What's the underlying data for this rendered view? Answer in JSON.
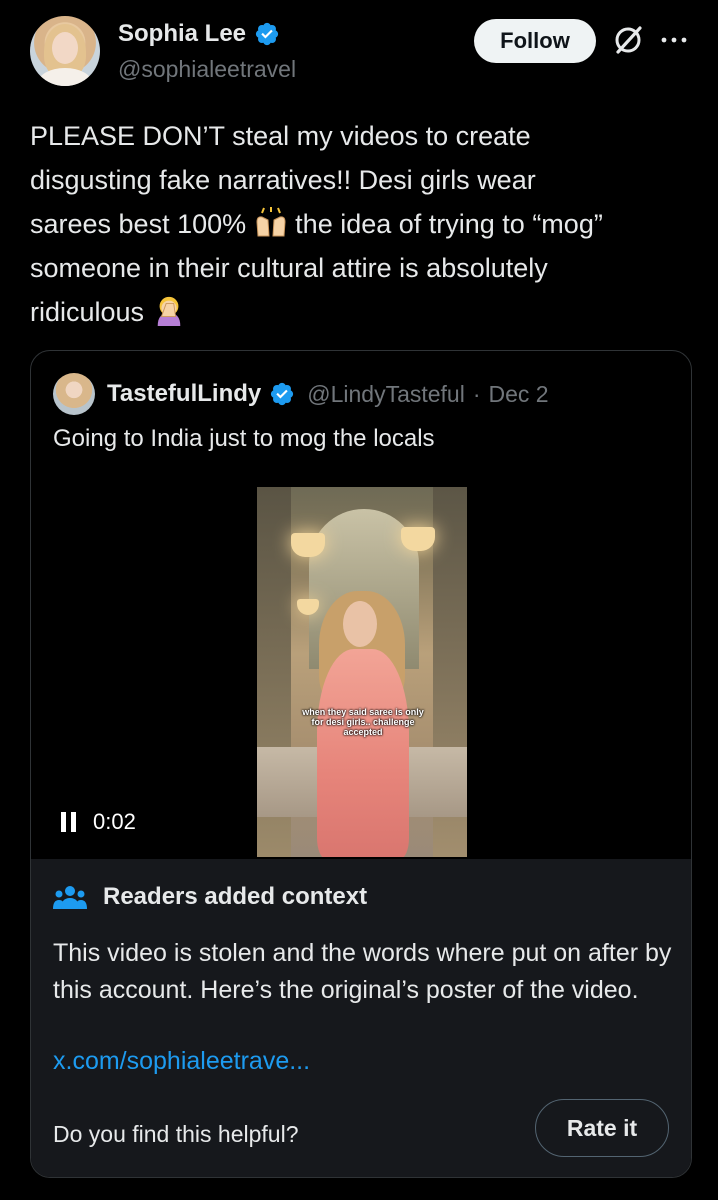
{
  "author": {
    "name": "Sophia Lee",
    "handle": "@sophialeetravel",
    "verified": true
  },
  "actions": {
    "follow_label": "Follow"
  },
  "icons": {
    "verified": "verified-badge-icon",
    "grok": "grok-icon",
    "more": "more-icon",
    "raised_hands": "raising-hands-emoji",
    "facepalm": "woman-facepalming-emoji",
    "pause": "pause-icon",
    "community_notes": "people-icon"
  },
  "tweet": {
    "line1": "PLEASE DON’T steal my videos to create",
    "line2": "disgusting fake narratives!! Desi girls wear",
    "line3a": "sarees best 100%",
    "line3b": "the idea of trying to “mog”",
    "line4": "someone in their cultural attire is absolutely",
    "line5": "ridiculous"
  },
  "quoted": {
    "name": "TastefulLindy",
    "handle": "@LindyTasteful",
    "separator": "·",
    "date": "Dec 2",
    "text": "Going to India just to mog the locals",
    "video": {
      "caption": "when they said saree is only for desi girls.. challenge accepted",
      "time": "0:02",
      "playing": true
    }
  },
  "context": {
    "title": "Readers added context",
    "body": "This video is stolen and the words where put on after by this account. Here’s the original’s poster of the video.",
    "link": "x.com/sophialeetrave...",
    "helpful_prompt": "Do you find this helpful?",
    "rate_label": "Rate it"
  },
  "colors": {
    "background": "#000000",
    "text": "#e7e9ea",
    "muted": "#71767b",
    "link": "#1d9bf0",
    "verified": "#1d9bf0",
    "note_bg": "#16181c"
  }
}
